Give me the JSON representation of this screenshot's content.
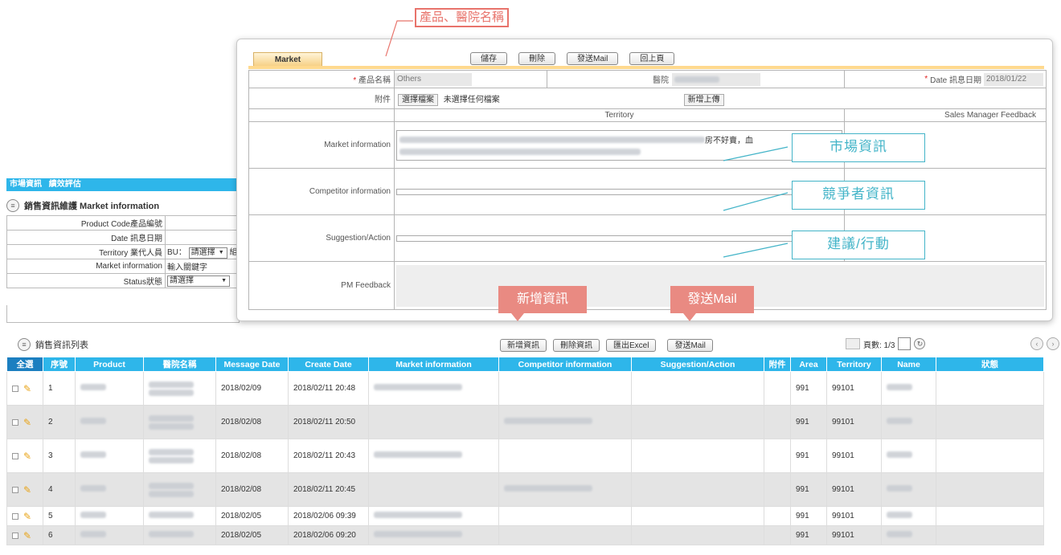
{
  "callouts": {
    "product_hospital": "產品、醫院名稱",
    "market_info": "市場資訊",
    "competitor_info": "競爭者資訊",
    "suggestion_action": "建議/行動",
    "add_info": "新增資訊",
    "send_mail": "發送Mail"
  },
  "form": {
    "tab_label": "Market",
    "toolbar": {
      "save": "儲存",
      "delete": "刪除",
      "send_mail": "發送Mail",
      "back": "回上頁"
    },
    "product_label": "產品名稱",
    "product_value": "Others",
    "hospital_label": "醫院",
    "date_label": "Date 訊息日期",
    "date_value": "2018/01/22",
    "attachment_label": "附件",
    "choose_file": "選擇檔案",
    "no_file": "未選擇任何檔案",
    "add_upload": "新增上傳",
    "col_territory": "Territory",
    "col_sm_feedback": "Sales Manager Feedback",
    "market_info_label": "Market information",
    "market_info_visible": "房不好賣，血",
    "competitor_label": "Competitor information",
    "suggestion_label": "Suggestion/Action",
    "pm_feedback_label": "PM Feedback"
  },
  "nav": {
    "item1": "市場資訊",
    "item2": "績效評估"
  },
  "search": {
    "title": "銷售資訊維護 Market information",
    "product_code_label": "Product Code產品編號",
    "date_label": "Date 訊息日期",
    "territory_label": "Territory 業代人員",
    "territory_bu": "BU：",
    "territory_select": "請選擇",
    "territory_group": "組",
    "market_info_label": "Market information",
    "market_info_placeholder": "輸入關鍵字",
    "status_label": "Status狀態",
    "status_select": "請選擇"
  },
  "list": {
    "title": "銷售資訊列表",
    "toolbar": {
      "add": "新增資訊",
      "delete": "刪除資訊",
      "export": "匯出Excel",
      "send_mail": "發送Mail"
    },
    "pager_label": "頁數: 1/3",
    "columns": [
      "全選",
      "序號",
      "Product",
      "醫院名稱",
      "Message Date",
      "Create Date",
      "Market information",
      "Competitor information",
      "Suggestion/Action",
      "附件",
      "Area",
      "Territory",
      "Name",
      "狀態"
    ],
    "rows": [
      {
        "no": "1",
        "message_date": "2018/02/09",
        "create_date": "2018/02/11 20:48",
        "area": "991",
        "territory": "99101"
      },
      {
        "no": "2",
        "message_date": "2018/02/08",
        "create_date": "2018/02/11 20:50",
        "area": "991",
        "territory": "99101"
      },
      {
        "no": "3",
        "message_date": "2018/02/08",
        "create_date": "2018/02/11 20:43",
        "area": "991",
        "territory": "99101"
      },
      {
        "no": "4",
        "message_date": "2018/02/08",
        "create_date": "2018/02/11 20:45",
        "area": "991",
        "territory": "99101"
      },
      {
        "no": "5",
        "message_date": "2018/02/05",
        "create_date": "2018/02/06 09:39",
        "area": "991",
        "territory": "99101"
      },
      {
        "no": "6",
        "message_date": "2018/02/05",
        "create_date": "2018/02/06 09:20",
        "area": "991",
        "territory": "99101"
      }
    ]
  },
  "colors": {
    "header_blue": "#2eb6ea",
    "callout_teal": "#43b4c8",
    "callout_pink": "#e98a82",
    "tab_orange": "#f6cf82"
  }
}
